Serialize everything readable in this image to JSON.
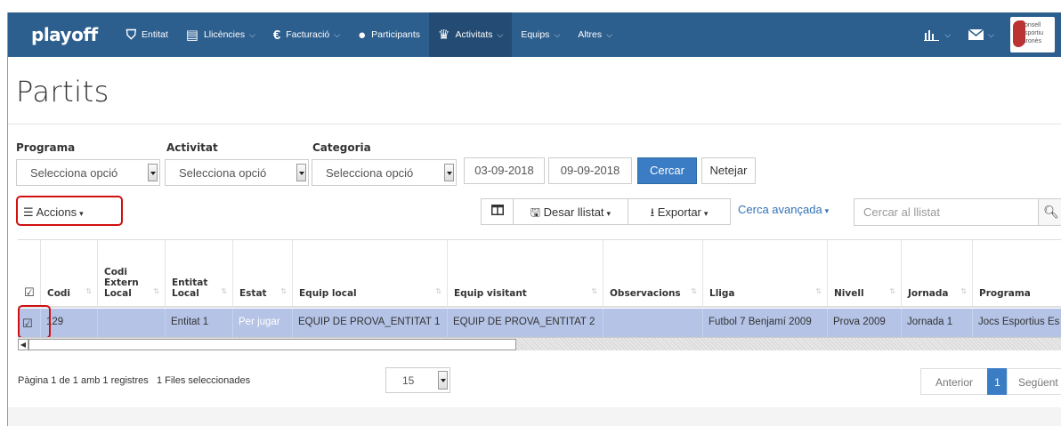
{
  "navbar": {
    "brand": "playoff",
    "items": [
      {
        "icon": "shield-icon",
        "glyph": "⛉",
        "label": "Entitat",
        "caret": false
      },
      {
        "icon": "id-card-icon",
        "glyph": "▤",
        "label": "Llicències",
        "caret": true
      },
      {
        "icon": "euro-icon",
        "glyph": "€",
        "label": "Facturació",
        "caret": true
      },
      {
        "icon": "user-icon",
        "glyph": "●",
        "label": "Participants",
        "caret": false
      },
      {
        "icon": "trophy-icon",
        "glyph": "♛",
        "label": "Activitats",
        "caret": true
      },
      {
        "icon": "",
        "glyph": "",
        "label": "Equips",
        "caret": true
      },
      {
        "icon": "",
        "glyph": "",
        "label": "Altres",
        "caret": true
      }
    ],
    "logo_text": "Consell Esportiu Gironès",
    "colors": {
      "bar": "#2c5e8e",
      "active": "#234b73"
    }
  },
  "page": {
    "title": "Partits"
  },
  "filters": {
    "programa_label": "Programa",
    "activitat_label": "Activitat",
    "categoria_label": "Categoria",
    "select_placeholder": "Selecciona opció",
    "date_from": "03-09-2018",
    "date_to": "09-09-2018",
    "search_button": "Cercar",
    "clear_button": "Netejar"
  },
  "toolbar": {
    "actions_label": "Accions",
    "save_list": "Desar llistat",
    "export": "Exportar",
    "advanced_search": "Cerca avançada",
    "list_search_placeholder": "Cercar al llistat"
  },
  "table": {
    "headers": [
      "",
      "Codi",
      "Codi Extern Local",
      "Entitat Local",
      "Estat",
      "Equip local",
      "Equip visitant",
      "Observacions",
      "Lliga",
      "Nivell",
      "Jornada",
      "Programa"
    ],
    "rows": [
      [
        "",
        "129",
        "",
        "Entitat 1",
        "Per jugar",
        "EQUIP DE PROVA_ENTITAT 1",
        "EQUIP DE PROVA_ENTITAT 2",
        "",
        "Futbol 7 Benjamí 2009",
        "Prova 2009",
        "Jornada 1",
        "Jocs Esportius Es"
      ]
    ],
    "selected_row_color": "#b4c3e6"
  },
  "footer": {
    "info": "Pàgina 1 de 1 amb 1 registres",
    "selected": "1 Files seleccionades",
    "page_size": "15",
    "prev": "Anterior",
    "current_page": "1",
    "next": "Següent"
  }
}
